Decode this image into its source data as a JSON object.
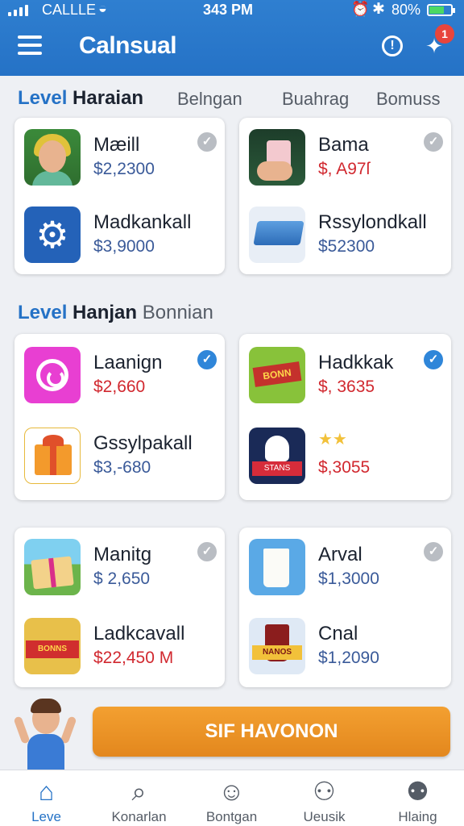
{
  "status_bar": {
    "carrier": "CALLLE",
    "time": "343 PM",
    "battery": "80%"
  },
  "header": {
    "title": "Calnsual",
    "notification_count": "1"
  },
  "section1": {
    "label_level": "Level",
    "label_name": "Haraian",
    "tabs": [
      "Belngan",
      "Buahrag",
      "Bomuss"
    ]
  },
  "section2": {
    "label_level": "Level",
    "label_name": "Hanjan",
    "subtitle": "Bonnian"
  },
  "items": [
    {
      "title": "Mæill",
      "price": "$2,2300",
      "icon": "person-thumb-icon"
    },
    {
      "title": "Bama",
      "price": "$, A97ſ",
      "icon": "milkshake-thumb-icon"
    },
    {
      "title": "Madkankall",
      "price": "$3,9000",
      "icon": "gear-thumb-icon"
    },
    {
      "title": "Rssylondkall",
      "price": "$52300",
      "icon": "box-thumb-icon"
    },
    {
      "title": "Laanign",
      "price": "$2,660",
      "icon": "circle-thumb-icon"
    },
    {
      "title": "Hadkkak",
      "price": "$, 3635",
      "icon": "bonus-thumb-icon"
    },
    {
      "title": "Gssylpakall",
      "price": "$3,-680",
      "icon": "gift-thumb-icon"
    },
    {
      "title": "",
      "price": "$,3055",
      "icon": "night-thumb-icon"
    },
    {
      "title": "Manitg",
      "price": "$ 2,650",
      "icon": "village-thumb-icon"
    },
    {
      "title": "Arval",
      "price": "$1,3000",
      "icon": "milk-thumb-icon"
    },
    {
      "title": "Ladkcavall",
      "price": "$22,450 M",
      "icon": "coins-thumb-icon"
    },
    {
      "title": "Cnal",
      "price": "$1,2090",
      "icon": "cup-thumb-icon"
    }
  ],
  "thumb_text": {
    "bonus": "BONN",
    "night": "STANS",
    "coins": "BONNS",
    "cup": "NANOS"
  },
  "cta": {
    "label": "SIF HAVONON"
  },
  "bottom_nav": [
    {
      "label": "Leve",
      "icon": "house-icon"
    },
    {
      "label": "Konarlan",
      "icon": "search-icon"
    },
    {
      "label": "Bontgan",
      "icon": "person-circle-icon"
    },
    {
      "label": "Ueusik",
      "icon": "users-icon"
    },
    {
      "label": "Hlaing",
      "icon": "profile-icon"
    }
  ],
  "colors": {
    "accent": "#2572c6",
    "price_blue": "#3a5a99",
    "price_red": "#d1282f",
    "cta": "#ee961f",
    "badge": "#e8453c"
  }
}
